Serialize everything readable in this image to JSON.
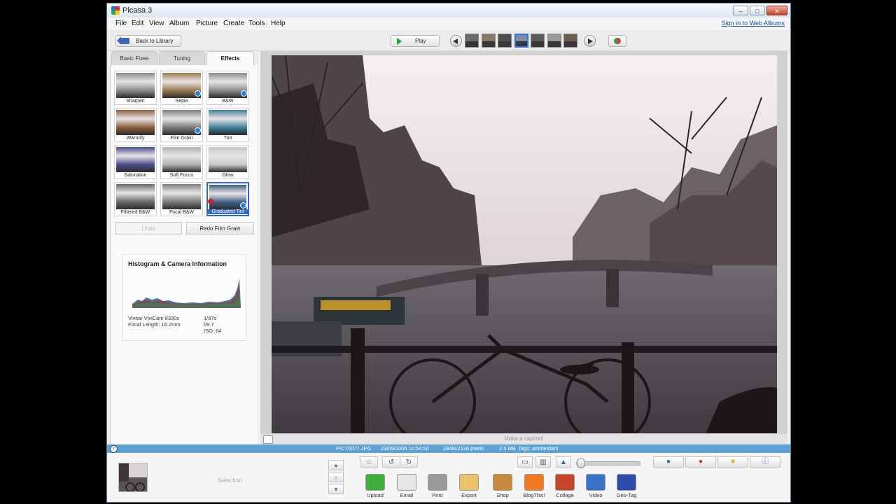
{
  "window": {
    "title": "Picasa 3",
    "controls": [
      "–",
      "□",
      "✕"
    ]
  },
  "menu": {
    "items": [
      "File",
      "Edit",
      "View",
      "Album",
      "Picture",
      "Create",
      "Tools",
      "Help"
    ],
    "signin": "Sign in to Web Albums"
  },
  "toolbar": {
    "back_label": "Back to Library",
    "play_label": "Play",
    "filmstrip_colors": [
      "#6a6a6a",
      "#8a7a63",
      "#4d4d4d",
      "#7c8ea0",
      "#5b5b5b",
      "#9a9a9a",
      "#6e5e4e"
    ]
  },
  "tabs": [
    "Basic Fixes",
    "Tuning",
    "Effects"
  ],
  "effects": [
    {
      "label": "Sharpen",
      "tint": "#8a8a8a"
    },
    {
      "label": "Sepia",
      "tint": "#9a7a4e"
    },
    {
      "label": "B&W",
      "tint": "#8c8c8c"
    },
    {
      "label": "Warmify",
      "tint": "#8a5f3e"
    },
    {
      "label": "Film Grain",
      "tint": "#7a7a7a"
    },
    {
      "label": "Tint",
      "tint": "#3f7f9a"
    },
    {
      "label": "Saturation",
      "tint": "#4a4f8c"
    },
    {
      "label": "Soft Focus",
      "tint": "#b0b0b0"
    },
    {
      "label": "Glow",
      "tint": "#c8c8c8"
    },
    {
      "label": "Filtered B&W",
      "tint": "#6a6a6a"
    },
    {
      "label": "Focal B&W",
      "tint": "#7d7d7d"
    },
    {
      "label": "Graduated Tint",
      "tint": "#3b5f80"
    }
  ],
  "actions": {
    "undo_label": "Undo",
    "redo_label": "Redo Film Grain"
  },
  "histogram": {
    "title": "Histogram & Camera Information",
    "camera": "Vivitar ViviCam 8330s",
    "focal_length": "Focal Length: 16.2mm",
    "exposure": "1/97s",
    "aperture": "f/9.7",
    "iso": "ISO: 64"
  },
  "caption": {
    "placeholder": "Make a caption!"
  },
  "status": {
    "filename": "PICT0077.JPG",
    "datetime": "23/09/2006 10:54:50",
    "dimensions": "2848x2136 pixels",
    "filesize": "2.5 MB",
    "tags": "Tags: amsterdam"
  },
  "tray": {
    "selection_label": "Selection"
  },
  "bottom_actions": [
    {
      "label": "Upload",
      "icon": "upload-icon",
      "color": "#3fae3f"
    },
    {
      "label": "Email",
      "icon": "email-icon",
      "color": "#e6e6e6"
    },
    {
      "label": "Print",
      "icon": "print-icon",
      "color": "#9a9a9a"
    },
    {
      "label": "Export",
      "icon": "export-folder-icon",
      "color": "#e8c36a"
    },
    {
      "label": "Shop",
      "icon": "shop-icon",
      "color": "#c98a3b"
    },
    {
      "label": "BlogThis!",
      "icon": "blogger-icon",
      "color": "#f17a22"
    },
    {
      "label": "Collage",
      "icon": "collage-icon",
      "color": "#c5452b"
    },
    {
      "label": "Video",
      "icon": "video-icon",
      "color": "#3b72c9"
    },
    {
      "label": "Geo-Tag",
      "icon": "geotag-icon",
      "color": "#2c4ea8"
    }
  ],
  "colors": {
    "status_bar": "#5da1d6",
    "selection_blue": "#2b67c6"
  }
}
